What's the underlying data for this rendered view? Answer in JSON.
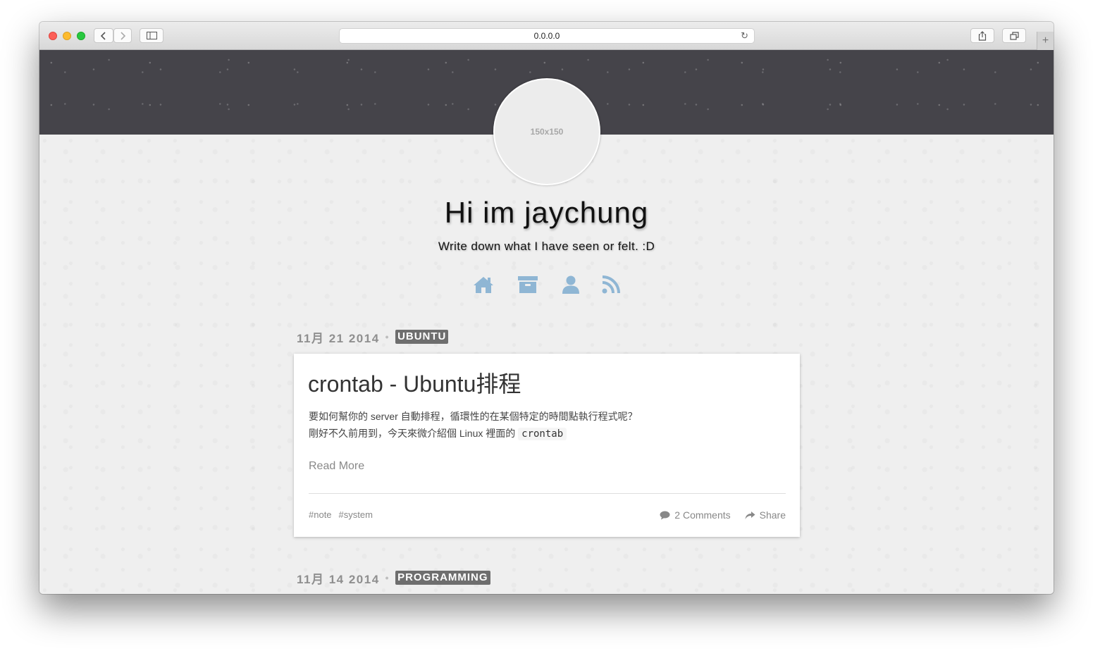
{
  "browser": {
    "url": "0.0.0.0",
    "new_tab_symbol": "+"
  },
  "blog": {
    "avatar_placeholder": "150x150",
    "title": "Hi im jaychung",
    "subtitle": "Write down what I have seen or felt. :D",
    "nav_icons": [
      "home-icon",
      "archive-icon",
      "user-icon",
      "rss-icon"
    ],
    "accent_color": "#8fb6d4"
  },
  "posts": [
    {
      "date": "11月 21 2014",
      "separator": "•",
      "category": "UBUNTU",
      "title": "crontab - Ubuntu排程",
      "excerpt_line1": "要如何幫你的 server 自動排程，循環性的在某個特定的時間點執行程式呢？",
      "excerpt_line2": "剛好不久前用到，今天來微介紹個 Linux 裡面的 ",
      "excerpt_code": "crontab",
      "read_more": "Read More",
      "tags": [
        "#note",
        "#system"
      ],
      "comments": "2 Comments",
      "share": "Share"
    },
    {
      "date": "11月 14 2014",
      "separator": "•",
      "category": "PROGRAMMING"
    }
  ]
}
